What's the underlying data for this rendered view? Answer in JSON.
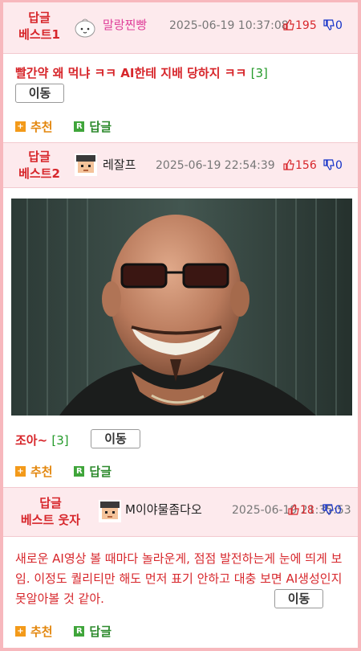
{
  "posts": [
    {
      "rank_line1": "답글",
      "rank_line2": "베스트1",
      "nickname": "말랑찐빵",
      "datetime": "2025-06-19 10:37:08",
      "upvotes": "195",
      "downvotes": "0",
      "text": "빨간약 왜 먹냐 ㅋㅋ AI한테 지배 당하지 ㅋㅋ",
      "comment_count": "[3]",
      "move_label": "이동",
      "recommend_label": "추천",
      "reply_label": "답글",
      "nick_color": "#e0409a"
    },
    {
      "rank_line1": "답글",
      "rank_line2": "베스트2",
      "nickname": "레잘프",
      "datetime": "2025-06-19 22:54:39",
      "upvotes": "156",
      "downvotes": "0",
      "text": "조아~",
      "comment_count": "[3]",
      "move_label": "이동",
      "recommend_label": "추천",
      "reply_label": "답글",
      "nick_color": "#222222"
    },
    {
      "rank_line1": "답글",
      "rank_line2": "베스트 웃자",
      "nickname": "M이야물좀다오",
      "datetime": "2025-06-19 21:35:53",
      "upvotes": "18",
      "downvotes": "0",
      "text": "새로운 AI영상 볼 때마다 놀라운게, 점점 발전하는게 눈에 띄게 보임. 이정도 퀄리티만 해도 먼저 표기 안하고 대충 보면 AI생성인지 못알아볼 것 같아.",
      "move_label": "이동",
      "recommend_label": "추천",
      "reply_label": "답글",
      "nick_color": "#222222"
    }
  ],
  "colors": {
    "accent": "#d7262b",
    "border": "#f7b8bd",
    "header_bg": "#fdeaed",
    "down": "#1230c8",
    "count": "#249a2a"
  }
}
